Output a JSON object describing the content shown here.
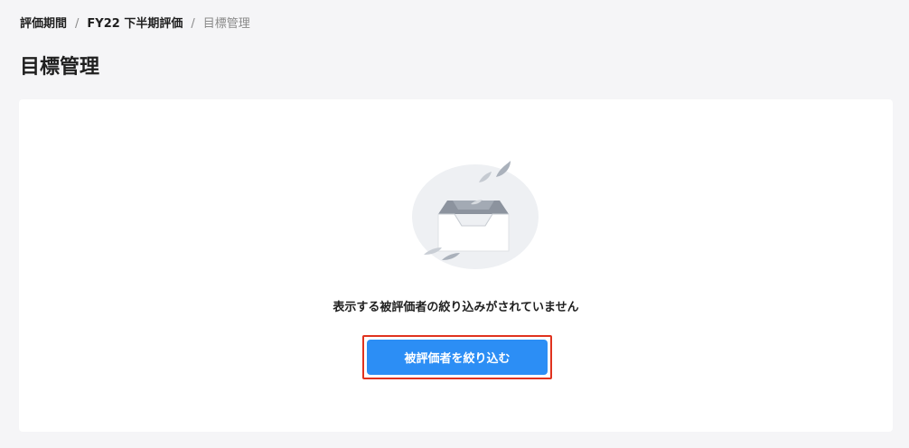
{
  "breadcrumb": {
    "items": [
      "評価期間",
      "FY22 下半期評価"
    ],
    "separator": "/",
    "current": "目標管理"
  },
  "page": {
    "title": "目標管理"
  },
  "empty_state": {
    "illustration": "empty-inbox-icon",
    "message": "表示する被評価者の絞り込みがされていません",
    "button_label": "被評価者を絞り込む"
  },
  "colors": {
    "page_background": "#f5f5f7",
    "panel_background": "#ffffff",
    "primary": "#2c8ef5",
    "highlight_border": "#e0321e"
  }
}
